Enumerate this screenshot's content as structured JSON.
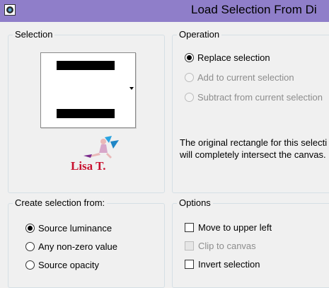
{
  "window": {
    "title": "Load Selection From Di"
  },
  "selection_group": {
    "legend": "Selection",
    "logo_text": "Lisa T."
  },
  "operation_group": {
    "legend": "Operation",
    "options": [
      {
        "label": "Replace selection",
        "checked": true,
        "enabled": true
      },
      {
        "label": "Add to current selection",
        "checked": false,
        "enabled": false
      },
      {
        "label": "Subtract from current selection",
        "checked": false,
        "enabled": false
      }
    ],
    "note_line1": "The original rectangle for this selecti",
    "note_line2": "will completely intersect the canvas."
  },
  "create_group": {
    "legend": "Create selection from:",
    "options": [
      {
        "label": "Source luminance",
        "checked": true
      },
      {
        "label": "Any non-zero value",
        "checked": false
      },
      {
        "label": "Source opacity",
        "checked": false
      }
    ]
  },
  "options_group": {
    "legend": "Options",
    "checkboxes": [
      {
        "label": "Move to upper left",
        "checked": false,
        "enabled": true
      },
      {
        "label": "Clip to canvas",
        "checked": false,
        "enabled": false
      },
      {
        "label": "Invert selection",
        "checked": false,
        "enabled": true
      }
    ]
  },
  "colors": {
    "titlebar": "#8f7ec9",
    "dialog_bg": "#f0f0f0",
    "group_border": "#d5dfe5",
    "logo_text": "#c8102e"
  }
}
